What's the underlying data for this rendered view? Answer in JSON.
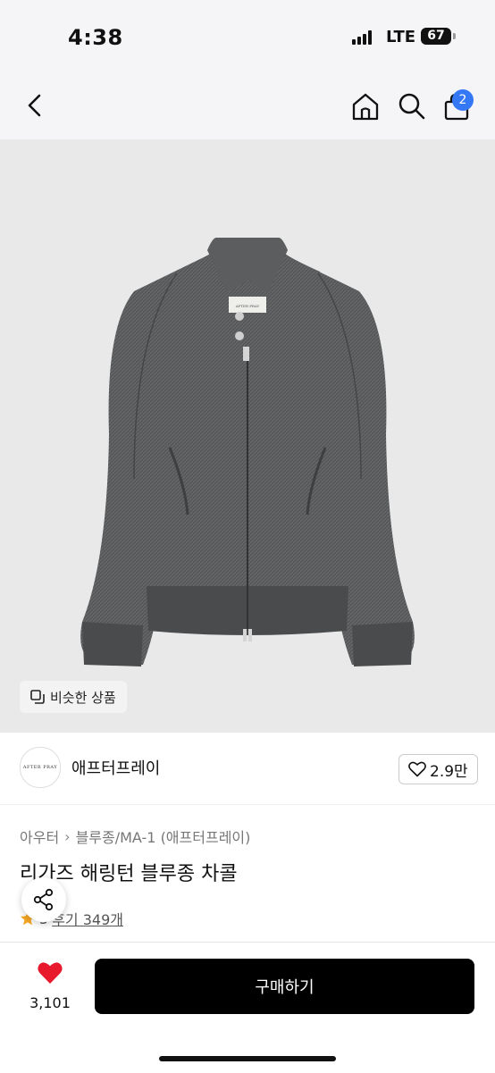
{
  "status_bar": {
    "time": "4:38",
    "network": "LTE",
    "battery": "67"
  },
  "header": {
    "back_icon": "chevron-left-icon",
    "home_icon": "home-icon",
    "search_icon": "search-icon",
    "cart_icon": "shopping-bag-icon",
    "cart_badge": "2"
  },
  "product_image": {
    "similar_label": "비슷한 상품"
  },
  "brand": {
    "logo_text": "AFTER PRAY",
    "name": "애프터프레이",
    "like_count": "2.9만"
  },
  "breadcrumb": {
    "items": [
      "아우터",
      "블루종/MA-1 (애프터프레이)"
    ]
  },
  "product": {
    "title": "리가즈 해링턴 블루종 차콜",
    "rating": "5",
    "reviews": "후기 349개"
  },
  "bottom_bar": {
    "like_count": "3,101",
    "buy_label": "구매하기"
  },
  "colors": {
    "accent_badge": "#3478f6",
    "like_heart": "#e8192c",
    "buy_button": "#000000",
    "star": "#f5a623"
  }
}
